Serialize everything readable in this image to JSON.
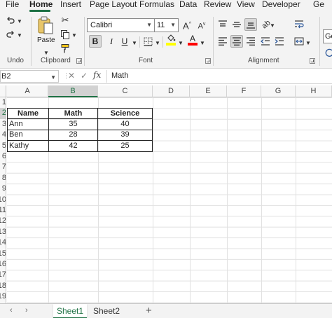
{
  "menu": {
    "tabs": [
      "File",
      "Home",
      "Insert",
      "Page Layout",
      "Formulas",
      "Data",
      "Review",
      "View",
      "Developer",
      "Ge"
    ],
    "active": "Home"
  },
  "ribbon": {
    "undo_label": "Undo",
    "clipboard_label": "Clipboard",
    "paste_label": "Paste",
    "font_label": "Font",
    "alignment_label": "Alignment",
    "font_name": "Calibri",
    "font_size": "11",
    "bold": "B",
    "italic": "I",
    "underline": "U",
    "styles_partial": "Ge",
    "accent_color": "#217346",
    "fill_color": "#ffff00",
    "font_color": "#ff0000"
  },
  "formula_bar": {
    "name_box": "B2",
    "fx": "fx",
    "value": "Math"
  },
  "columns": [
    "A",
    "B",
    "C",
    "D",
    "E",
    "F",
    "G",
    "H"
  ],
  "rows": [
    "1",
    "2",
    "3",
    "4",
    "5",
    "6",
    "7",
    "8",
    "9",
    "10",
    "11",
    "12",
    "13",
    "14",
    "15",
    "16",
    "17",
    "18",
    "19"
  ],
  "table": {
    "headers": [
      "Name",
      "Math",
      "Science"
    ],
    "rows": [
      [
        "Ann",
        "35",
        "40"
      ],
      [
        "Ben",
        "28",
        "39"
      ],
      [
        "Kathy",
        "42",
        "25"
      ]
    ]
  },
  "sheets": [
    "Sheet1",
    "Sheet2"
  ],
  "active_sheet": "Sheet1",
  "add_sheet": "+"
}
